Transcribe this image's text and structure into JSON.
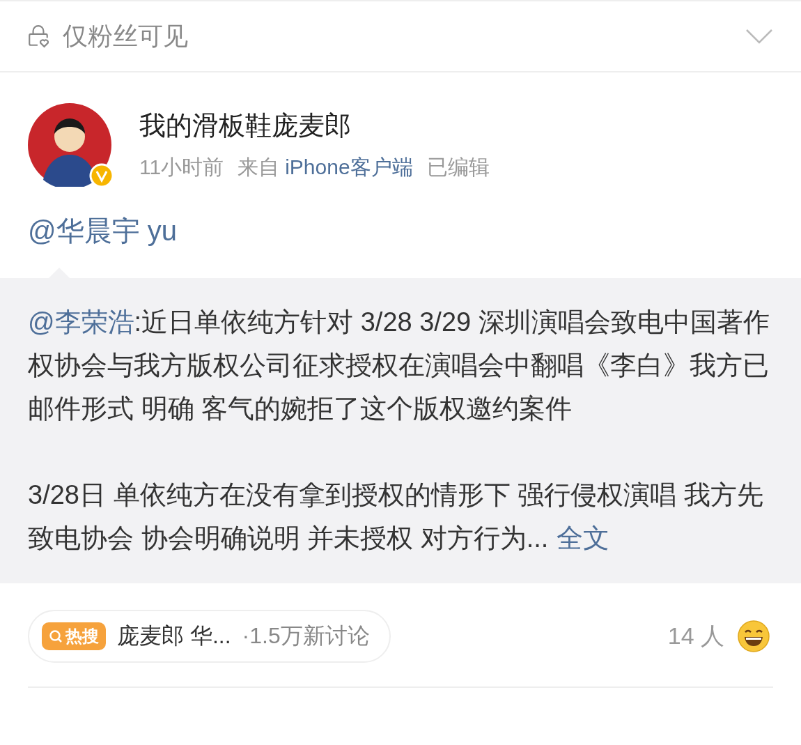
{
  "visibility": {
    "label": "仅粉丝可见"
  },
  "post": {
    "author": "我的滑板鞋庞麦郎",
    "verified": true,
    "time": "11小时前",
    "source_prefix": "来自",
    "source": "iPhone客户端",
    "edited": "已编辑",
    "mention": "@华晨宇 yu",
    "repost": {
      "paragraphs": [
        {
          "mention": "@李荣浩",
          "text": ":近日单依纯方针对 3/28 3/29 深圳演唱会致电中国著作权协会与我方版权公司征求授权在演唱会中翻唱《李白》我方已邮件形式 明确 客气的婉拒了这个版权邀约案件"
        },
        {
          "text": "3/28日 单依纯方在没有拿到授权的情形下 强行侵权演唱 我方先致电协会 协会明确说明 并未授权 对方行为...",
          "link": "全文"
        }
      ]
    },
    "hot_search": {
      "badge": "热搜",
      "topic": "庞麦郎 华...",
      "discussion": "·1.5万新讨论"
    },
    "likes": {
      "count": "14 人"
    }
  }
}
